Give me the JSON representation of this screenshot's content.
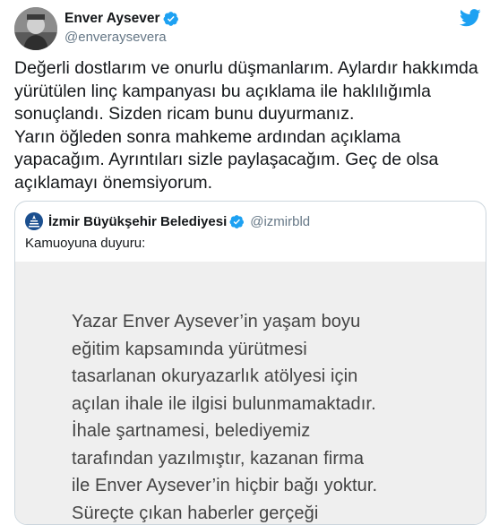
{
  "author": {
    "name": "Enver Aysever",
    "handle": "@enveraysevera",
    "verified": true
  },
  "tweet": {
    "text": "Değerli dostlarım ve onurlu düşmanlarım. Aylardır hakkımda\nyürütülen linç kampanyası bu açıklama ile haklılığımla\nsonuçlandı. Sizden ricam bunu duyurmanız.\nYarın öğleden sonra mahkeme ardından açıklama\nyapacağım. Ayrıntıları sizle paylaşacağım. Geç de olsa\naçıklamayı önemsiyorum."
  },
  "quoted_tweet": {
    "author_name": "İzmir Büyükşehir Belediyesi",
    "author_handle": "@izmirbld",
    "verified": true,
    "text": "Kamuoyuna duyuru:",
    "image_text": "Yazar Enver Aysever’in yaşam boyu\neğitim kapsamında yürütmesi\ntasarlanan okuryazarlık atölyesi için\naçılan ihale ile ilgisi bulunmamaktadır.\nİhale şartnamesi, belediyemiz\ntarafından yazılmıştır, kazanan firma\nile Enver Aysever’in hiçbir bağı yoktur.\nSüreçte çıkan haberler gerçeği"
  },
  "icons": {
    "verified": "verified-badge-icon",
    "twitter": "twitter-bird-icon",
    "org_logo": "izmir-logo-icon"
  },
  "colors": {
    "twitter_blue": "#1da1f2",
    "text": "#14171a",
    "secondary": "#657786",
    "border": "#ccd6dd"
  }
}
